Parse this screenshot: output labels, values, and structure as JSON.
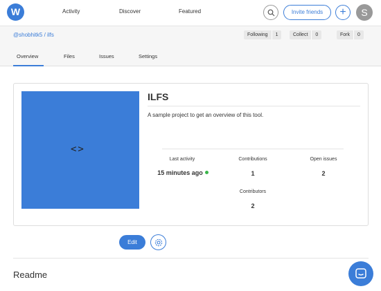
{
  "app": {
    "logo_letter": "W",
    "nav": [
      "Activity",
      "Discover",
      "Featured"
    ],
    "invite_label": "Invite friends",
    "plus_label": "+",
    "avatar_letter": "S",
    "accent": "#3b7dd8"
  },
  "project": {
    "breadcrumb": "@shobhitk5 / ilfs",
    "counters": [
      {
        "label": "Following",
        "count": "1"
      },
      {
        "label": "Collect",
        "count": "0"
      },
      {
        "label": "Fork",
        "count": "0"
      }
    ],
    "tabs": [
      "Overview",
      "Files",
      "Issues",
      "Settings"
    ],
    "active_tab": "Overview",
    "title": "ILFS",
    "description": "A sample project to get an overview of this tool.",
    "thumbnail_icon": "code-icon",
    "stats": {
      "last_activity_label": "Last activity",
      "last_activity_value": "15 minutes ago",
      "contributions_label": "Contributions",
      "contributions_value": "1",
      "open_issues_label": "Open issues",
      "open_issues_value": "2",
      "contributors_label": "Contributors",
      "contributors_value": "2"
    },
    "edit_label": "Edit",
    "readme_heading": "Readme"
  },
  "icons": {
    "search": "search-icon",
    "settings": "gear-icon",
    "chat": "chat-icon"
  }
}
